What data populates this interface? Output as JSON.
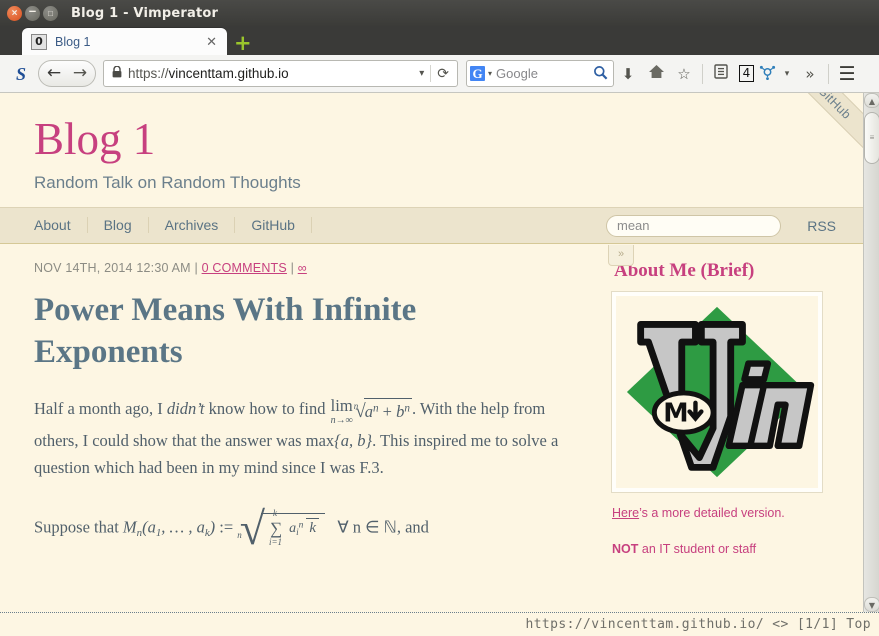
{
  "window": {
    "title": "Blog 1 - Vimperator",
    "controls": {
      "close": "×",
      "minimize": "–",
      "maximize": "□"
    }
  },
  "tabbar": {
    "tab_number": "0",
    "tab_label": "Blog 1",
    "close_label": "✕",
    "new_tab_label": "+"
  },
  "toolbar": {
    "scribe_icon": "S",
    "back_label": "←",
    "forward_label": "→",
    "lock_icon": "ὑ2",
    "url_scheme": "https://",
    "url_host": "vincenttam.github.io",
    "url_caret": "▾",
    "reload_label": "⟳",
    "search_engine": "G",
    "search_caret": "▾",
    "search_placeholder": "Google",
    "search_go": "⚲",
    "download_icon": "⬇",
    "home_icon": "⌂",
    "bookmark_icon": "☆",
    "library_icon": "☰",
    "badge_count": "4",
    "molecule_icon": "☸",
    "overflow_caret": "▾",
    "chevrons": "»",
    "menu_icon": "☰"
  },
  "site": {
    "title": "Blog 1",
    "subtitle": "Random Talk on Random Thoughts",
    "ribbon": "Fork me on GitHub",
    "nav": [
      "About",
      "Blog",
      "Archives",
      "GitHub"
    ],
    "search_value": "mean",
    "rss_label": "RSS",
    "sidebar_toggle": "»"
  },
  "post": {
    "date": "NOV 14TH, 2014 12:30 AM",
    "sep1": " | ",
    "comments_link": "0 COMMENTS",
    "sep2": " | ",
    "permalink": "∞",
    "title": "Power Means With Infinite Exponents",
    "paragraph1_a": "Half a month ago, I ",
    "paragraph1_italic": "didn’t",
    "paragraph1_b": " know how to find ",
    "lim_op": "lim",
    "lim_sub": "n→∞",
    "radical_index": "n",
    "radical_symbol": "√",
    "radicand": "a",
    "radicand_exp": "n",
    "radicand_plus": " + ",
    "radicand_b": "b",
    "radicand_b_exp": "n",
    "paragraph1_c": ". With the help from others, I could show that the answer was ",
    "max_op": "max",
    "max_set": "{a, b}",
    "paragraph1_d": ". This inspired me to solve a question which had been in my mind since I was F.3.",
    "paragraph2_a": "Suppose that ",
    "formula_M": "M",
    "formula_M_sub": "n",
    "formula_args": "(a",
    "formula_arg1_sub": "1",
    "formula_args_mid": ", … , a",
    "formula_argk_sub": "k",
    "formula_args_end": ")",
    "formula_assign": ":=",
    "formula_root_index": "n",
    "formula_root_symbol": "√",
    "sum_symbol": "∑",
    "sum_upper": "k",
    "sum_lower": "i=1",
    "sum_term": "a",
    "sum_term_sub": "i",
    "sum_term_sup": "n",
    "denominator": "k",
    "formula_tail": "∀ n ∈ ℕ, and"
  },
  "sidebar": {
    "heading": "About Me (Brief)",
    "image_alt": "Vim logo",
    "vim_badge": "M",
    "link_text": "Here",
    "link_rest": "’s a more detailed version.",
    "not_label": "NOT",
    "not_rest": " an IT student or staff"
  },
  "statusline": {
    "text": "https://vincenttam.github.io/ <> [1/1] Top"
  },
  "scrollbar": {
    "up": "▲",
    "down": "▼",
    "grip": "≡"
  },
  "colors": {
    "page_bg": "#fdf6e3",
    "accent_pink": "#c7407f",
    "text_blue_gray": "#51606b",
    "nav_bg": "#ece4cd",
    "titlebar": "#3b3b38"
  }
}
